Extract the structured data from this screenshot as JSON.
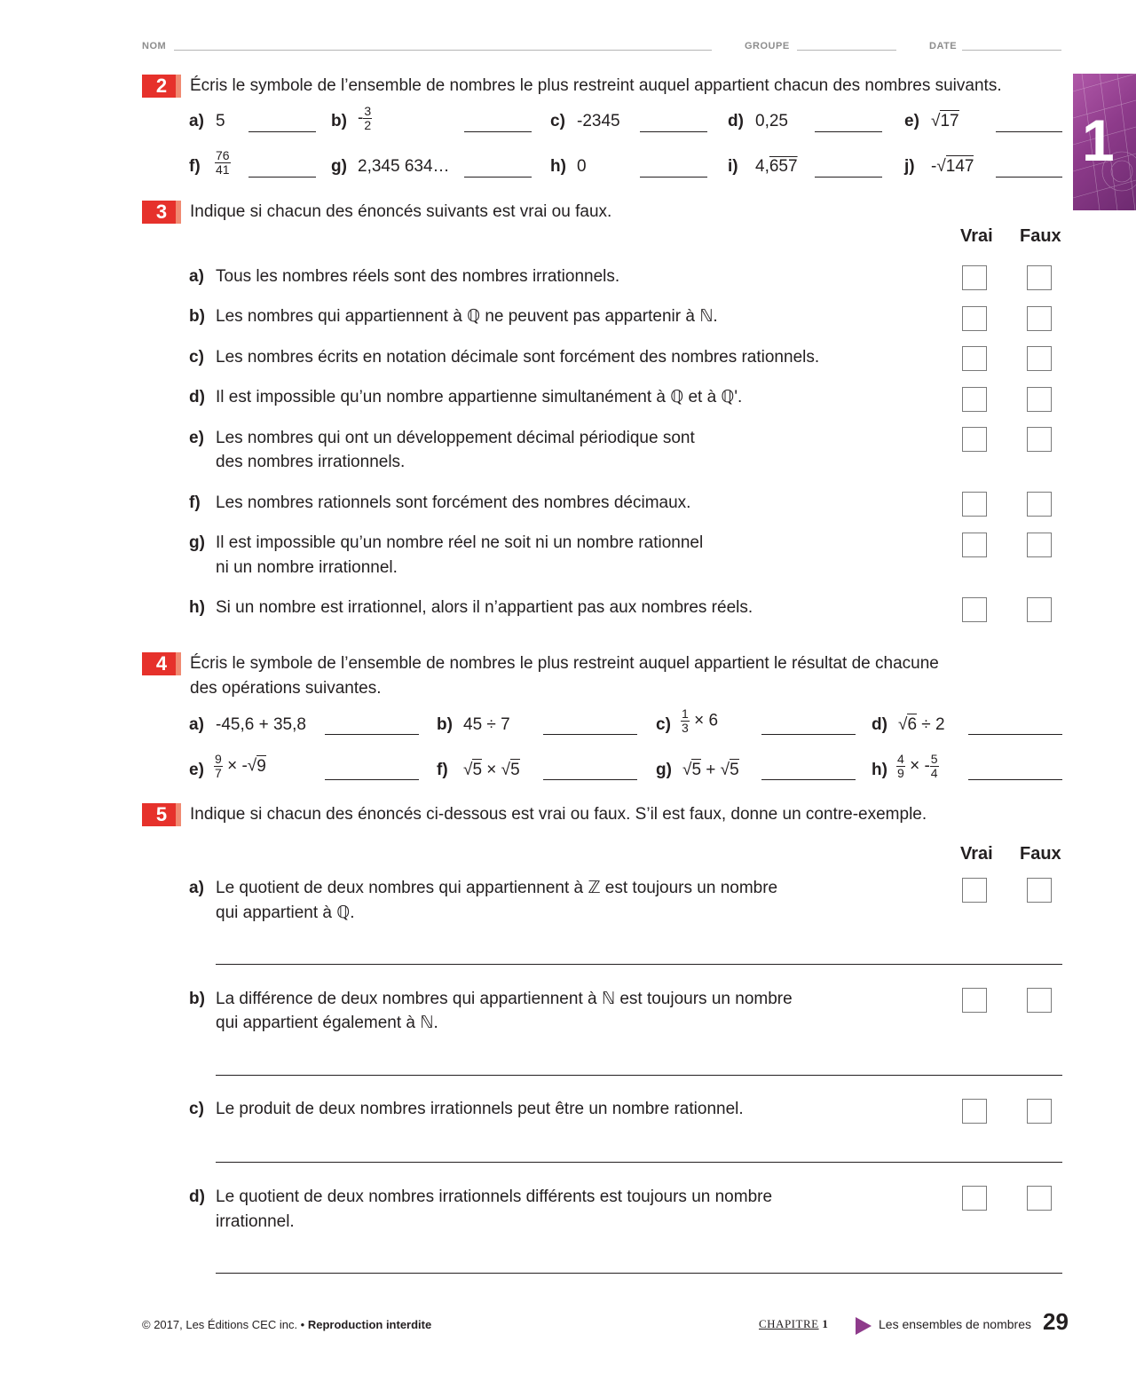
{
  "header": {
    "nom": "NOM",
    "groupe": "GROUPE",
    "date": "DATE"
  },
  "chapter_tab": {
    "number": "1"
  },
  "ex2": {
    "number": "2",
    "instruction": "Écris le symbole de l’ensemble de nombres le plus restreint auquel appartient chacun des nombres suivants.",
    "items": [
      {
        "label": "a)",
        "value": "5"
      },
      {
        "label": "b)",
        "sign": "-",
        "num": "3",
        "den": "2"
      },
      {
        "label": "c)",
        "value": "-2345"
      },
      {
        "label": "d)",
        "value": "0,25"
      },
      {
        "label": "e)",
        "sqrt": "17"
      },
      {
        "label": "f)",
        "num": "76",
        "den": "41"
      },
      {
        "label": "g)",
        "value": "2,345 634…"
      },
      {
        "label": "h)",
        "value": "0"
      },
      {
        "label": "i)",
        "prefix": "4,",
        "overline": "657"
      },
      {
        "label": "j)",
        "sign": "-",
        "sqrt": "147"
      }
    ]
  },
  "ex3": {
    "number": "3",
    "instruction": "Indique si chacun des énoncés suivants est vrai ou faux.",
    "col_true": "Vrai",
    "col_false": "Faux",
    "items": [
      {
        "label": "a)",
        "line1": "Tous les nombres réels sont des nombres irrationnels.",
        "line2": ""
      },
      {
        "label": "b)",
        "line1": "Les nombres qui appartiennent à ℚ ne peuvent pas appartenir à ℕ.",
        "line2": ""
      },
      {
        "label": "c)",
        "line1": "Les nombres écrits en notation décimale sont forcément des nombres rationnels.",
        "line2": ""
      },
      {
        "label": "d)",
        "line1": "Il est impossible qu’un nombre appartienne simultanément à ℚ et à ℚ'.",
        "line2": ""
      },
      {
        "label": "e)",
        "line1": "Les nombres qui ont un développement décimal périodique sont",
        "line2": "des nombres irrationnels."
      },
      {
        "label": "f)",
        "line1": "Les nombres rationnels sont forcément des nombres décimaux.",
        "line2": ""
      },
      {
        "label": "g)",
        "line1": "Il est impossible qu’un nombre réel ne soit ni un nombre rationnel",
        "line2": "ni un nombre irrationnel."
      },
      {
        "label": "h)",
        "line1": "Si un nombre est irrationnel, alors il n’appartient pas aux nombres réels.",
        "line2": ""
      }
    ]
  },
  "ex4": {
    "number": "4",
    "instruction_line1": "Écris le symbole de l’ensemble de nombres le plus restreint auquel appartient le résultat de chacune",
    "instruction_line2": "des opérations suivantes.",
    "items": [
      {
        "label": "a)",
        "expr": "-45,6 + 35,8"
      },
      {
        "label": "b)",
        "expr": "45 ÷ 7"
      },
      {
        "label": "c)",
        "num": "1",
        "den": "3",
        "tail": "× 6"
      },
      {
        "label": "d)",
        "sqrt": "6",
        "tail": "÷ 2"
      },
      {
        "label": "e)",
        "num": "9",
        "den": "7",
        "tail": "× -",
        "sqrt": "9"
      },
      {
        "label": "f)",
        "sqrt": "5",
        "mid": "×",
        "sqrt2": "5"
      },
      {
        "label": "g)",
        "sqrt": "5",
        "mid": "+",
        "sqrt2": "5"
      },
      {
        "label": "h)",
        "num": "4",
        "den": "9",
        "mid": "× -",
        "num2": "5",
        "den2": "4"
      }
    ]
  },
  "ex5": {
    "number": "5",
    "instruction": "Indique si chacun des énoncés ci-dessous est vrai ou faux. S’il est faux, donne un contre-exemple.",
    "col_true": "Vrai",
    "col_false": "Faux",
    "items": [
      {
        "label": "a)",
        "line1": "Le quotient de deux nombres qui appartiennent à ℤ est toujours un nombre",
        "line2": "qui appartient à ℚ."
      },
      {
        "label": "b)",
        "line1": "La différence de deux nombres qui appartiennent à ℕ est toujours un nombre",
        "line2": "qui appartient également à ℕ."
      },
      {
        "label": "c)",
        "line1": "Le produit de deux nombres irrationnels peut être un nombre rationnel.",
        "line2": ""
      },
      {
        "label": "d)",
        "line1": "Le quotient de deux nombres irrationnels différents est toujours un nombre",
        "line2": "irrationnel."
      }
    ]
  },
  "footer": {
    "copyright": "© 2017, Les Éditions CEC inc. •",
    "rights": "Reproduction interdite",
    "chapter_word": "CHAPITRE",
    "chapter_num": "1",
    "chapter_title": "Les ensembles de nombres",
    "page": "29"
  },
  "colors": {
    "accent_red": "#e6312b",
    "tab_purple": "#8e3b8b"
  },
  "icons": {
    "arrow": "triangle-right-icon"
  }
}
